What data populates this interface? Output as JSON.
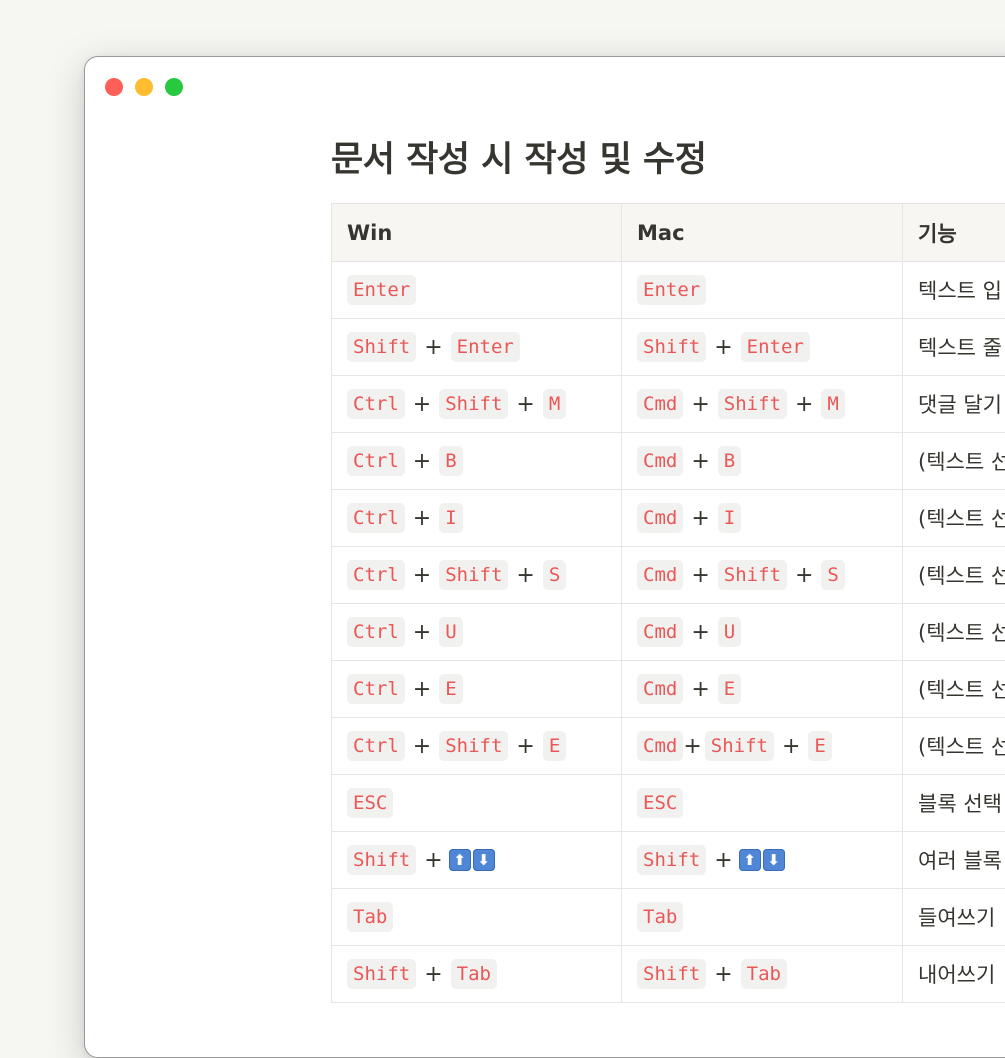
{
  "colors": {
    "key_text": "#eb5757",
    "key_bg": "#f1f1ef",
    "header_bg": "#f7f6f3"
  },
  "title": "문서 작성 시 작성 및 수정",
  "columns": [
    "Win",
    "Mac",
    "기능"
  ],
  "rows": [
    {
      "win": [
        "Enter"
      ],
      "mac": [
        "Enter"
      ],
      "desc": "텍스트 입"
    },
    {
      "win": [
        "Shift",
        "Enter"
      ],
      "mac": [
        "Shift",
        "Enter"
      ],
      "desc": "텍스트 줄"
    },
    {
      "win": [
        "Ctrl",
        "Shift",
        "M"
      ],
      "mac": [
        "Cmd",
        "Shift",
        "M"
      ],
      "desc": "댓글 달기"
    },
    {
      "win": [
        "Ctrl",
        "B"
      ],
      "mac": [
        "Cmd",
        "B"
      ],
      "desc": "(텍스트 선"
    },
    {
      "win": [
        "Ctrl",
        "I"
      ],
      "mac": [
        "Cmd",
        "I"
      ],
      "desc": "(텍스트 선"
    },
    {
      "win": [
        "Ctrl",
        "Shift",
        "S"
      ],
      "mac": [
        "Cmd",
        "Shift",
        "S"
      ],
      "desc": "(텍스트 선"
    },
    {
      "win": [
        "Ctrl",
        "U"
      ],
      "mac": [
        "Cmd",
        "U"
      ],
      "desc": "(텍스트 선"
    },
    {
      "win": [
        "Ctrl",
        "E"
      ],
      "mac": [
        "Cmd",
        "E"
      ],
      "desc": "(텍스트 선"
    },
    {
      "win": [
        "Ctrl",
        "Shift",
        "E"
      ],
      "mac": [
        "Cmd",
        "Shift",
        "E"
      ],
      "mac_tight_first": true,
      "desc": "(텍스트 선"
    },
    {
      "win": [
        "ESC"
      ],
      "mac": [
        "ESC"
      ],
      "desc": "블록 선택"
    },
    {
      "win": [
        "Shift"
      ],
      "win_arrows": true,
      "mac": [
        "Shift"
      ],
      "mac_arrows": true,
      "desc": "여러 블록"
    },
    {
      "win": [
        "Tab"
      ],
      "mac": [
        "Tab"
      ],
      "desc": "들여쓰기"
    },
    {
      "win": [
        "Shift",
        "Tab"
      ],
      "mac": [
        "Shift",
        "Tab"
      ],
      "desc": "내어쓰기"
    }
  ],
  "separator": "+",
  "arrow_icons": [
    "arrow-up-icon",
    "arrow-down-icon"
  ],
  "arrow_glyphs": [
    "⬆",
    "⬇"
  ]
}
